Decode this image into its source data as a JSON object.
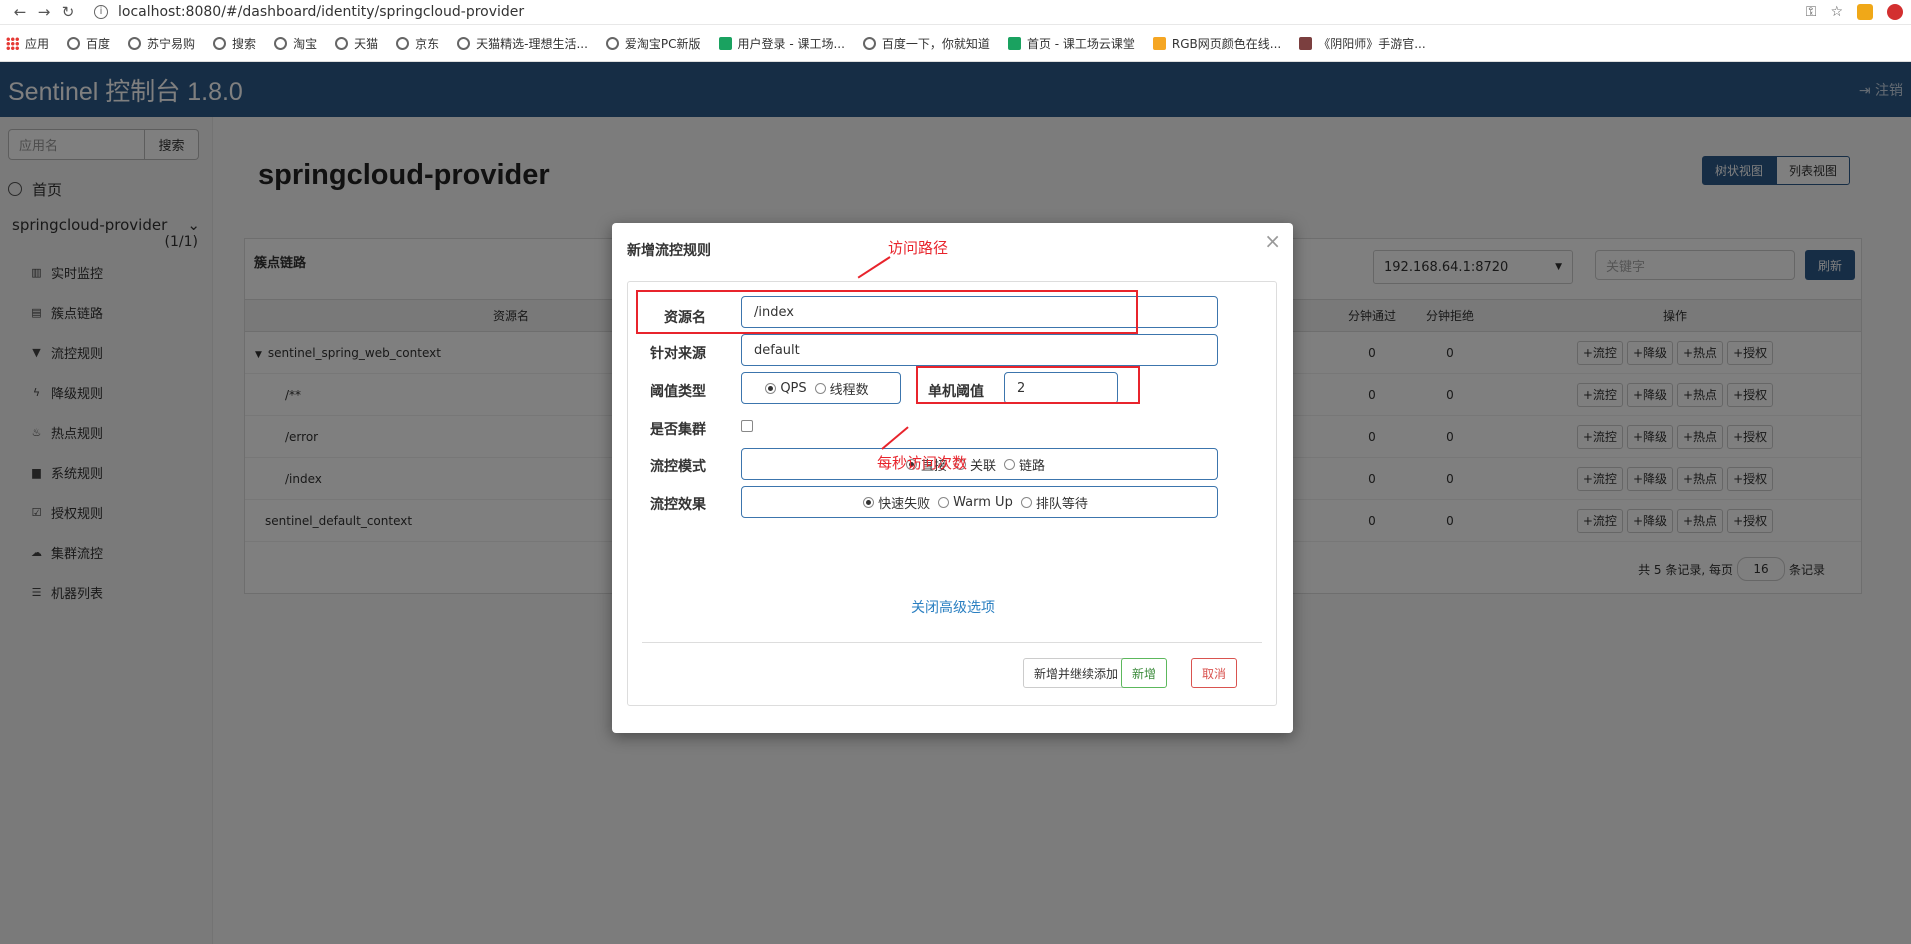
{
  "browser": {
    "url": "localhost:8080/#/dashboard/identity/springcloud-provider",
    "bookmarks": [
      "应用",
      "百度",
      "苏宁易购",
      "搜索",
      "淘宝",
      "天猫",
      "京东",
      "天猫精选-理想生活...",
      "爱淘宝PC新版",
      "用户登录 - 课工场...",
      "百度一下，你就知道",
      "首页 - 课工场云课堂",
      "RGB网页颜色在线...",
      "《阴阳师》手游官..."
    ]
  },
  "header": {
    "title": "Sentinel 控制台 1.8.0",
    "logout": "注销"
  },
  "sidebar": {
    "search_placeholder": "应用名",
    "search_button": "搜索",
    "home": "首页",
    "app_name": "springcloud-provider",
    "app_count": "(1/1)",
    "items": [
      {
        "label": "实时监控",
        "icon": "chart-icon"
      },
      {
        "label": "簇点链路",
        "icon": "list-icon"
      },
      {
        "label": "流控规则",
        "icon": "filter-icon"
      },
      {
        "label": "降级规则",
        "icon": "bolt-icon"
      },
      {
        "label": "热点规则",
        "icon": "fire-icon"
      },
      {
        "label": "系统规则",
        "icon": "lock-icon"
      },
      {
        "label": "授权规则",
        "icon": "check-icon"
      },
      {
        "label": "集群流控",
        "icon": "cloud-icon"
      },
      {
        "label": "机器列表",
        "icon": "th-list-icon"
      }
    ]
  },
  "main": {
    "title": "springcloud-provider",
    "view_tree": "树状视图",
    "view_list": "列表视图",
    "panel_title": "簇点链路",
    "machine": "192.168.64.1:8720",
    "keyword_placeholder": "关键字",
    "refresh": "刷新",
    "columns": {
      "resource": "资源名",
      "pass": "分钟通过",
      "block": "分钟拒绝",
      "ops": "操作"
    },
    "rows": [
      {
        "name": "sentinel_spring_web_context",
        "pass": "0",
        "block": "0",
        "tree": true
      },
      {
        "name": "/**",
        "pass": "0",
        "block": "0"
      },
      {
        "name": "/error",
        "pass": "0",
        "block": "0"
      },
      {
        "name": "/index",
        "pass": "0",
        "block": "0"
      },
      {
        "name": "sentinel_default_context",
        "pass": "0",
        "block": "0"
      }
    ],
    "op_labels": [
      "+流控",
      "+降级",
      "+热点",
      "+授权"
    ],
    "pager_prefix": "共 5 条记录, 每页",
    "pager_size": "16",
    "pager_suffix": "条记录"
  },
  "modal": {
    "title": "新增流控规则",
    "resource_label": "资源名",
    "resource_value": "/index",
    "source_label": "针对来源",
    "source_value": "default",
    "threshold_type_label": "阈值类型",
    "threshold_qps": "QPS",
    "threshold_thread": "线程数",
    "single_threshold_label": "单机阈值",
    "single_threshold_value": "2",
    "cluster_label": "是否集群",
    "mode_label": "流控模式",
    "mode_direct": "直接",
    "mode_relate": "关联",
    "mode_chain": "链路",
    "effect_label": "流控效果",
    "effect_fast": "快速失败",
    "effect_warmup": "Warm Up",
    "effect_queue": "排队等待",
    "advanced_link": "关闭高级选项",
    "btn_add_continue": "新增并继续添加",
    "btn_add": "新增",
    "btn_cancel": "取消"
  },
  "annotations": {
    "path_note": "访问路径",
    "qps_note": "每秒访问次数"
  },
  "colors": {
    "header": "#2d5b8a",
    "annotation": "#e8242c",
    "link": "#2a7fc1"
  }
}
